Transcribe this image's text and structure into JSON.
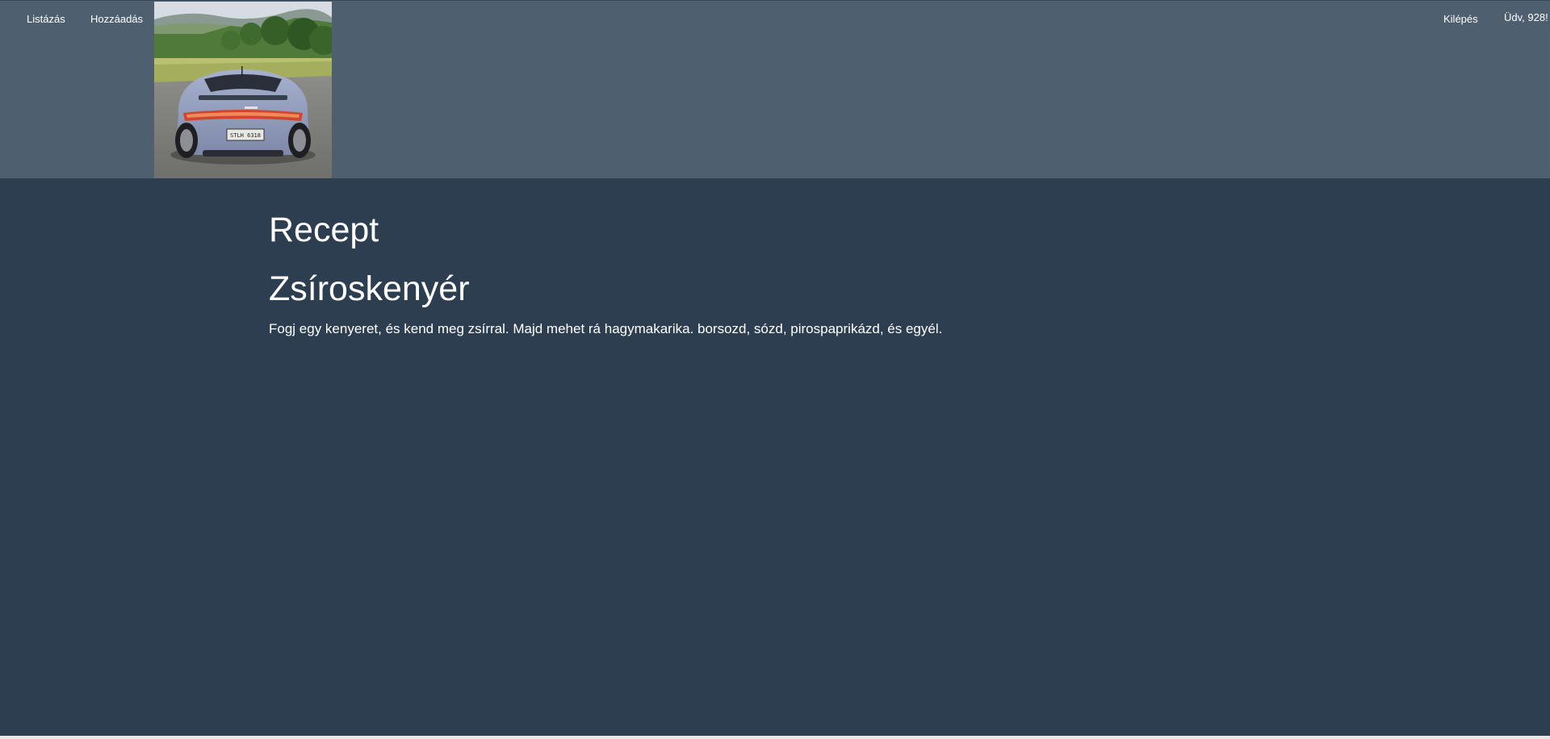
{
  "nav": {
    "listazas": "Listázás",
    "hozzaadas": "Hozzáadás",
    "kilepes": "Kilépés",
    "greeting": "Üdv, 928!"
  },
  "header_image": {
    "alt": "car-photo",
    "plate": "STLH 6318"
  },
  "main": {
    "title": "Recept",
    "recipe_name": "Zsíroskenyér",
    "recipe_text": "Fogj egy kenyeret, és kend meg zsírral. Majd mehet rá hagymakarika. borsozd, sózd, pirospaprikázd, és egyél."
  },
  "colors": {
    "navbar": "#4e5f6f",
    "background": "#2c3e50",
    "text": "#ffffff"
  }
}
